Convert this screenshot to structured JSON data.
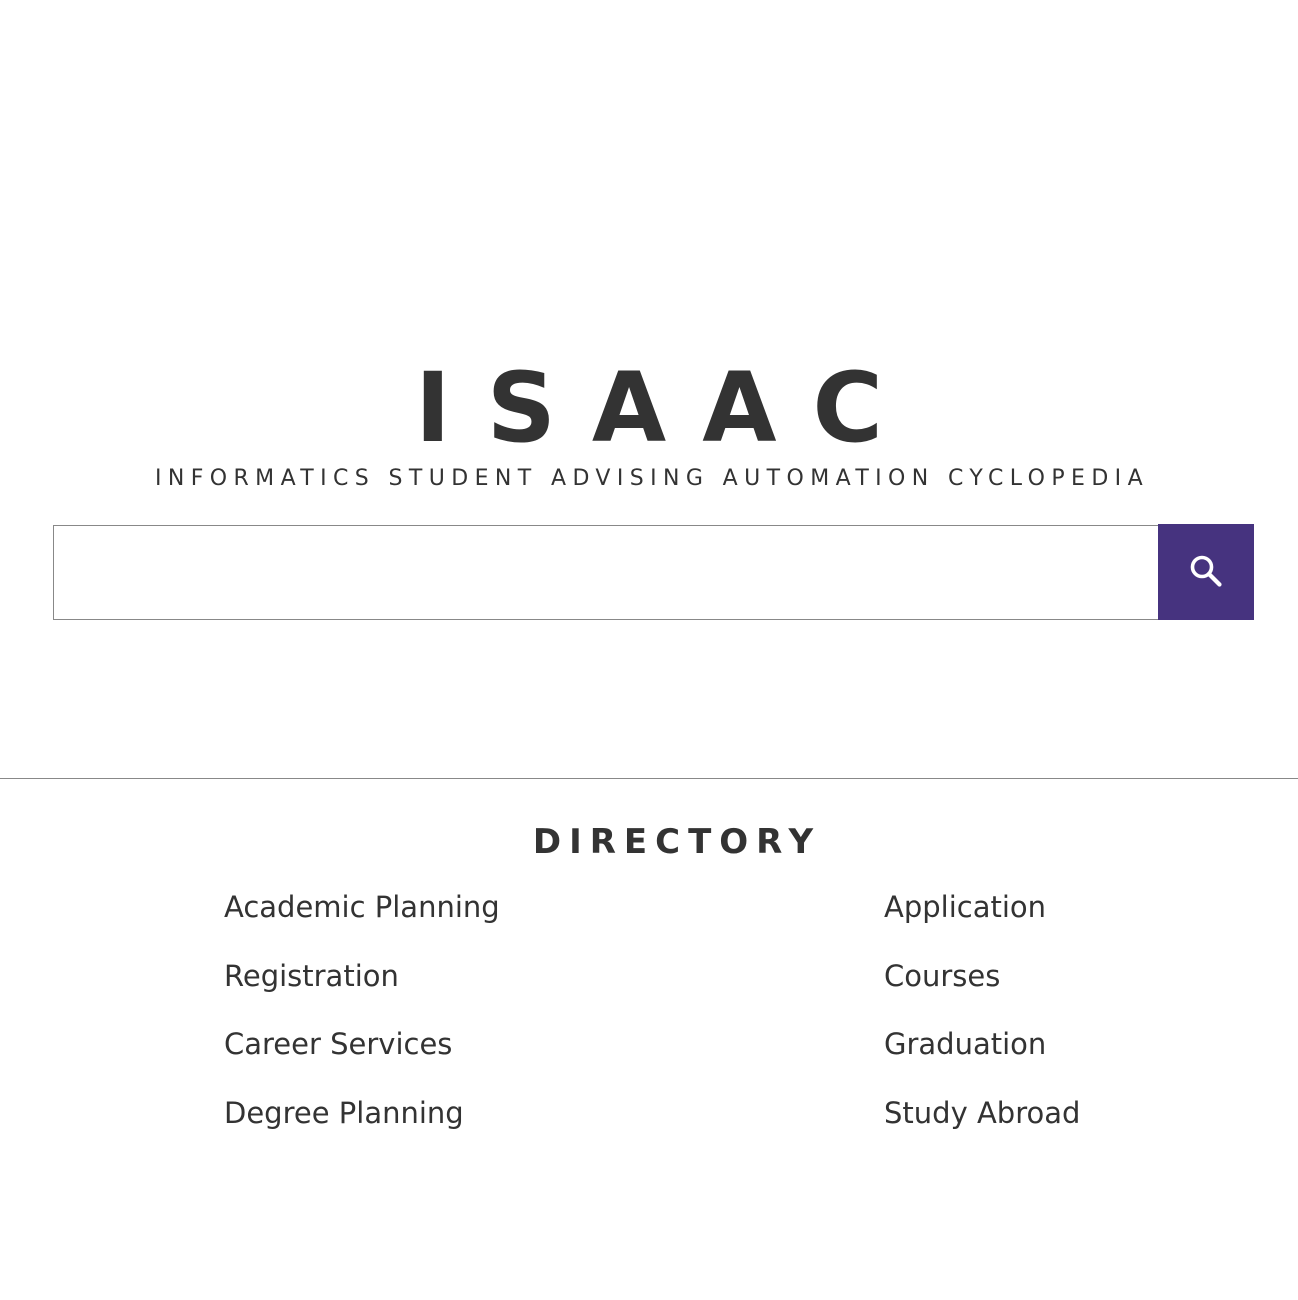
{
  "header": {
    "logo": "ISAAC",
    "tagline": "INFORMATICS STUDENT ADVISING AUTOMATION CYCLOPEDIA"
  },
  "search": {
    "value": "",
    "placeholder": "",
    "button_icon": "search-icon",
    "button_color": "#46337f"
  },
  "directory": {
    "heading": "DIRECTORY",
    "left_links": [
      "Academic Planning",
      "Registration",
      "Career Services",
      "Degree Planning"
    ],
    "right_links": [
      "Application",
      "Courses",
      "Graduation",
      "Study Abroad"
    ]
  }
}
